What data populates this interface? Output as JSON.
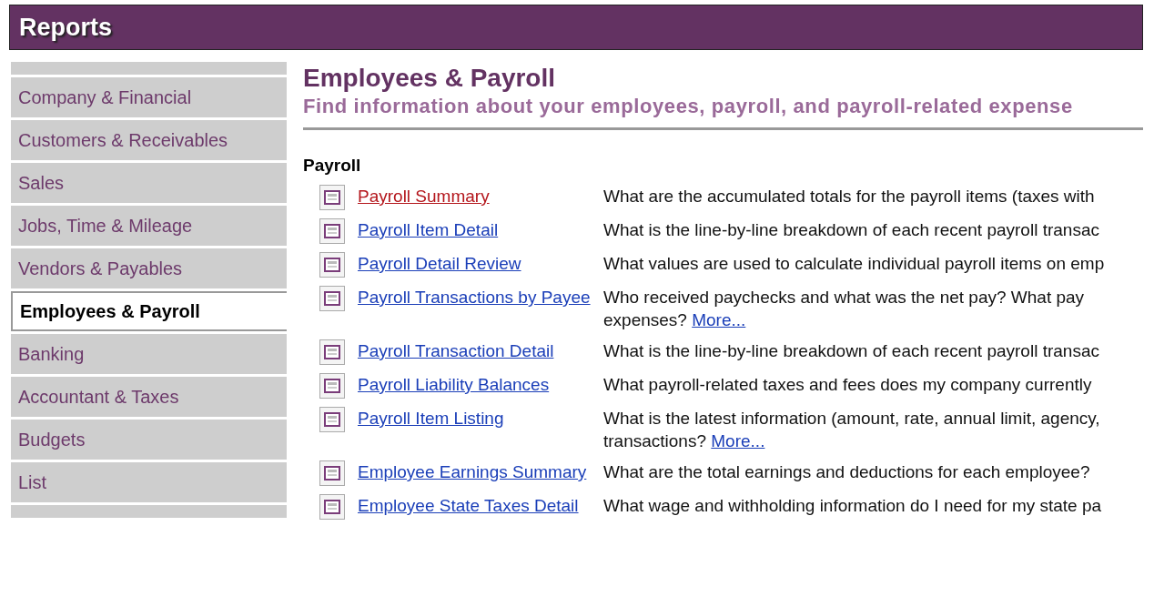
{
  "window": {
    "title": "Reports"
  },
  "sidebar": {
    "items": [
      {
        "label": "Company & Financial",
        "selected": false
      },
      {
        "label": "Customers & Receivables",
        "selected": false
      },
      {
        "label": "Sales",
        "selected": false
      },
      {
        "label": "Jobs, Time & Mileage",
        "selected": false
      },
      {
        "label": "Vendors & Payables",
        "selected": false
      },
      {
        "label": "Employees & Payroll",
        "selected": true
      },
      {
        "label": "Banking",
        "selected": false
      },
      {
        "label": "Accountant & Taxes",
        "selected": false
      },
      {
        "label": "Budgets",
        "selected": false
      },
      {
        "label": "List",
        "selected": false
      }
    ]
  },
  "content": {
    "title": "Employees & Payroll",
    "subtitle": "Find information about your employees, payroll, and payroll-related expense",
    "section": "Payroll",
    "reports": [
      {
        "name": "Payroll Summary",
        "visited": true,
        "description": [
          "What are the accumulated totals for the payroll items (taxes with"
        ]
      },
      {
        "name": "Payroll Item Detail",
        "visited": false,
        "description": [
          "What is the line-by-line breakdown of each recent payroll transac"
        ]
      },
      {
        "name": "Payroll Detail Review",
        "visited": false,
        "description": [
          "What values are used to calculate individual payroll items on emp"
        ]
      },
      {
        "name": "Payroll Transactions by Payee",
        "visited": false,
        "description": [
          "Who received paychecks and what was the net pay? What pay",
          "expenses?"
        ],
        "more": "More..."
      },
      {
        "name": "Payroll Transaction Detail",
        "visited": false,
        "description": [
          "What is the line-by-line breakdown of each recent payroll transac"
        ]
      },
      {
        "name": "Payroll Liability Balances",
        "visited": false,
        "description": [
          "What payroll-related taxes and fees does my company currently"
        ]
      },
      {
        "name": "Payroll Item Listing",
        "visited": false,
        "description": [
          "What is the latest information (amount, rate, annual limit, agency,",
          "transactions?"
        ],
        "more": "More..."
      },
      {
        "name": "Employee Earnings Summary",
        "visited": false,
        "description": [
          "What are the total earnings and deductions for each employee?"
        ]
      },
      {
        "name": "Employee State Taxes Detail",
        "visited": false,
        "description": [
          "What wage and withholding information do I need for my state pa"
        ]
      }
    ]
  }
}
